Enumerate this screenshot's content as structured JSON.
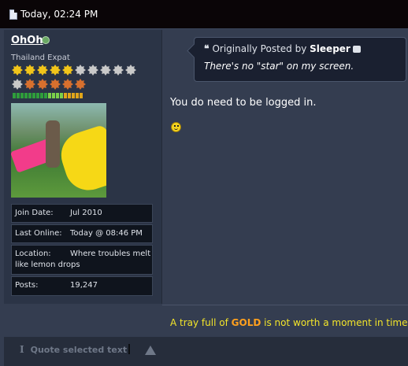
{
  "post": {
    "date": "Today, 02:24 PM"
  },
  "user": {
    "name": "OhOh",
    "title": "Thailand Expat",
    "stars_row1": [
      "gold",
      "gold",
      "gold",
      "gold",
      "gold",
      "gray",
      "gray",
      "gray",
      "gray",
      "gray"
    ],
    "stars_row2": [
      "gray",
      "orange",
      "orange",
      "orange",
      "orange",
      "orange"
    ],
    "reputation_colors": [
      "#2f9e3b",
      "#2f9e3b",
      "#2f9e3b",
      "#2f9e3b",
      "#2f9e3b",
      "#2f9e3b",
      "#2f9e3b",
      "#2f9e3b",
      "#2f9e3b",
      "#7bd14a",
      "#7bd14a",
      "#7bd14a",
      "#7bd14a",
      "#e0a51a",
      "#e0a51a",
      "#e0a51a",
      "#e0a51a",
      "#e0a51a"
    ],
    "join_label": "Join Date:",
    "join_value": "Jul 2010",
    "online_label": "Last Online:",
    "online_value": "Today @ 08:46 PM",
    "location_label": "Location:",
    "location_value": "Where troubles melt",
    "location_value2": "like lemon drops",
    "posts_label": "Posts:",
    "posts_value": "19,247"
  },
  "quote": {
    "prefix": "Originally Posted by",
    "author": "Sleeper",
    "text": "There's no \"star\" on my screen."
  },
  "message": {
    "text": "You do need to be logged in."
  },
  "signature": {
    "before": "A tray full of",
    "highlight": "GOLD",
    "after": "is not worth a moment in time."
  },
  "footer": {
    "quote_label": "Quote selected text"
  },
  "colors": {
    "header_bg": "#0a0507",
    "post_bg": "#343d50",
    "signature": "#f3e52a",
    "gold_word": "#ffa01e"
  }
}
